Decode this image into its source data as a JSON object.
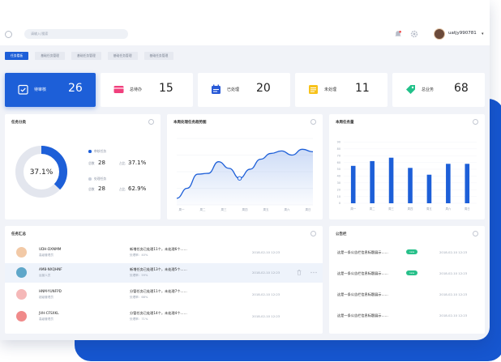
{
  "header": {
    "search_placeholder": "请输入/搜索",
    "username": "uatjy990781",
    "caret": "▾"
  },
  "tabs": [
    {
      "label": "任务看板",
      "active": true
    },
    {
      "label": "基础任务管理",
      "active": false
    },
    {
      "label": "基础任务管理",
      "active": false
    },
    {
      "label": "基础任务管理",
      "active": false
    },
    {
      "label": "基础任务管理",
      "active": false
    }
  ],
  "stats": [
    {
      "label": "待审核",
      "value": "26",
      "icon": "check-icon",
      "color": "#1d5fd8"
    },
    {
      "label": "总待办",
      "value": "15",
      "icon": "card-icon",
      "color": "#f0407d"
    },
    {
      "label": "已处理",
      "value": "20",
      "icon": "calendar-icon",
      "color": "#2a5bd7"
    },
    {
      "label": "未处理",
      "value": "11",
      "icon": "list-icon",
      "color": "#f7c21a"
    },
    {
      "label": "总业务",
      "value": "68",
      "icon": "tag-icon",
      "color": "#22c18a"
    }
  ],
  "task_category": {
    "title": "任务分类",
    "center": "37.1%",
    "items": [
      {
        "name": "审核任务",
        "count_label": "总数",
        "count": "28",
        "pct_label": "占比",
        "pct": "37.1%",
        "color": "#1d5fd8"
      },
      {
        "name": "处理任务",
        "count_label": "总数",
        "count": "28",
        "pct_label": "占比",
        "pct": "62.9%",
        "color": "#c9cfdb"
      }
    ]
  },
  "weekly_trend": {
    "title": "本周处理任务趋势图"
  },
  "weekly_volume": {
    "title": "本周任务量"
  },
  "task_summary": {
    "title": "任务汇总",
    "rows": [
      {
        "code": "UDH-DXNMM",
        "role": "高级管理员",
        "msg": "新增任务已处理11个，未处理6个……",
        "rate": "处理率：40%",
        "date": "2018-02-10 12:23"
      },
      {
        "code": "AM8-NXQHNF",
        "role": "运营人员",
        "msg": "新增任务已处理13个，未处理5个……",
        "rate": "处理率：59%",
        "date": "2018-02-10 12:23"
      },
      {
        "code": "HNM-YUNFPD",
        "role": "超级管理员",
        "msg": "分管任务已处理11个，未处理7个……",
        "rate": "处理率：68%",
        "date": "2018-02-10 12:23"
      },
      {
        "code": "JVH-CFSXKL",
        "role": "高级管理员",
        "msg": "分管任务已处理14个，未处理4个……",
        "rate": "处理率：71%",
        "date": "2018-02-10 12:23"
      }
    ]
  },
  "notice": {
    "title": "公告栏",
    "items": [
      {
        "text": "这是一条公告栏信息标题展示……",
        "badge": "new",
        "date": "2018-02-10 12:23"
      },
      {
        "text": "这是一条公告栏信息标题展示……",
        "badge": "new",
        "date": "2018-02-10 12:23"
      },
      {
        "text": "这是一条公告栏信息标题展示……",
        "badge": "",
        "date": "2018-02-10 12:23"
      },
      {
        "text": "这是一条公告栏信息标题展示……",
        "badge": "",
        "date": "2018-02-10 12:23"
      }
    ]
  },
  "chart_data": [
    {
      "type": "pie",
      "categories": [
        "审核任务",
        "处理任务"
      ],
      "values": [
        37.1,
        62.9
      ],
      "colors": [
        "#1d5fd8",
        "#e3e6ee"
      ]
    },
    {
      "type": "area",
      "categories": [
        "周一",
        "周二",
        "周三",
        "周四",
        "周五",
        "周六",
        "周日"
      ],
      "values": [
        8,
        20,
        37,
        38,
        52,
        44,
        32,
        43,
        55,
        62,
        65,
        60,
        67,
        64
      ],
      "color": "#1d5fd8",
      "grid": true
    },
    {
      "type": "bar",
      "categories": [
        "周一",
        "周二",
        "周三",
        "周四",
        "周五",
        "周六",
        "周日"
      ],
      "values": [
        55,
        62,
        67,
        52,
        42,
        58,
        58
      ],
      "ylim": [
        0,
        100
      ],
      "yticks": [
        "0",
        "10",
        "20",
        "30",
        "40",
        "50",
        "60",
        "70",
        "80",
        "90"
      ],
      "color": "#1d5fd8",
      "grid": true
    }
  ]
}
